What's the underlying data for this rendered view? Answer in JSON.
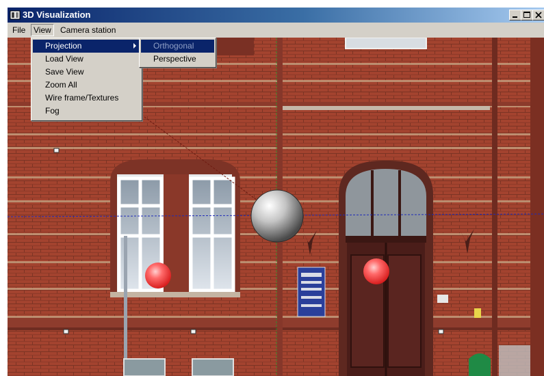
{
  "window": {
    "title": "3D Visualization"
  },
  "menubar": {
    "file": "File",
    "view": "View",
    "camera": "Camera station"
  },
  "view_menu": {
    "items": [
      "Projection",
      "Load View",
      "Save View",
      "Zoom All",
      "Wire frame/Textures",
      "Fog"
    ]
  },
  "projection_submenu": {
    "items": [
      "Orthogonal",
      "Perspective"
    ]
  },
  "colors": {
    "titlebar_start": "#0a246a",
    "highlight": "#0a246a",
    "brick": "#a14534",
    "marker_red": "#e83a3a"
  },
  "icons": {
    "app": "app-window-icon",
    "minimize": "minimize-icon",
    "maximize": "maximize-icon",
    "close": "close-icon",
    "submenu": "submenu-arrow-icon"
  }
}
